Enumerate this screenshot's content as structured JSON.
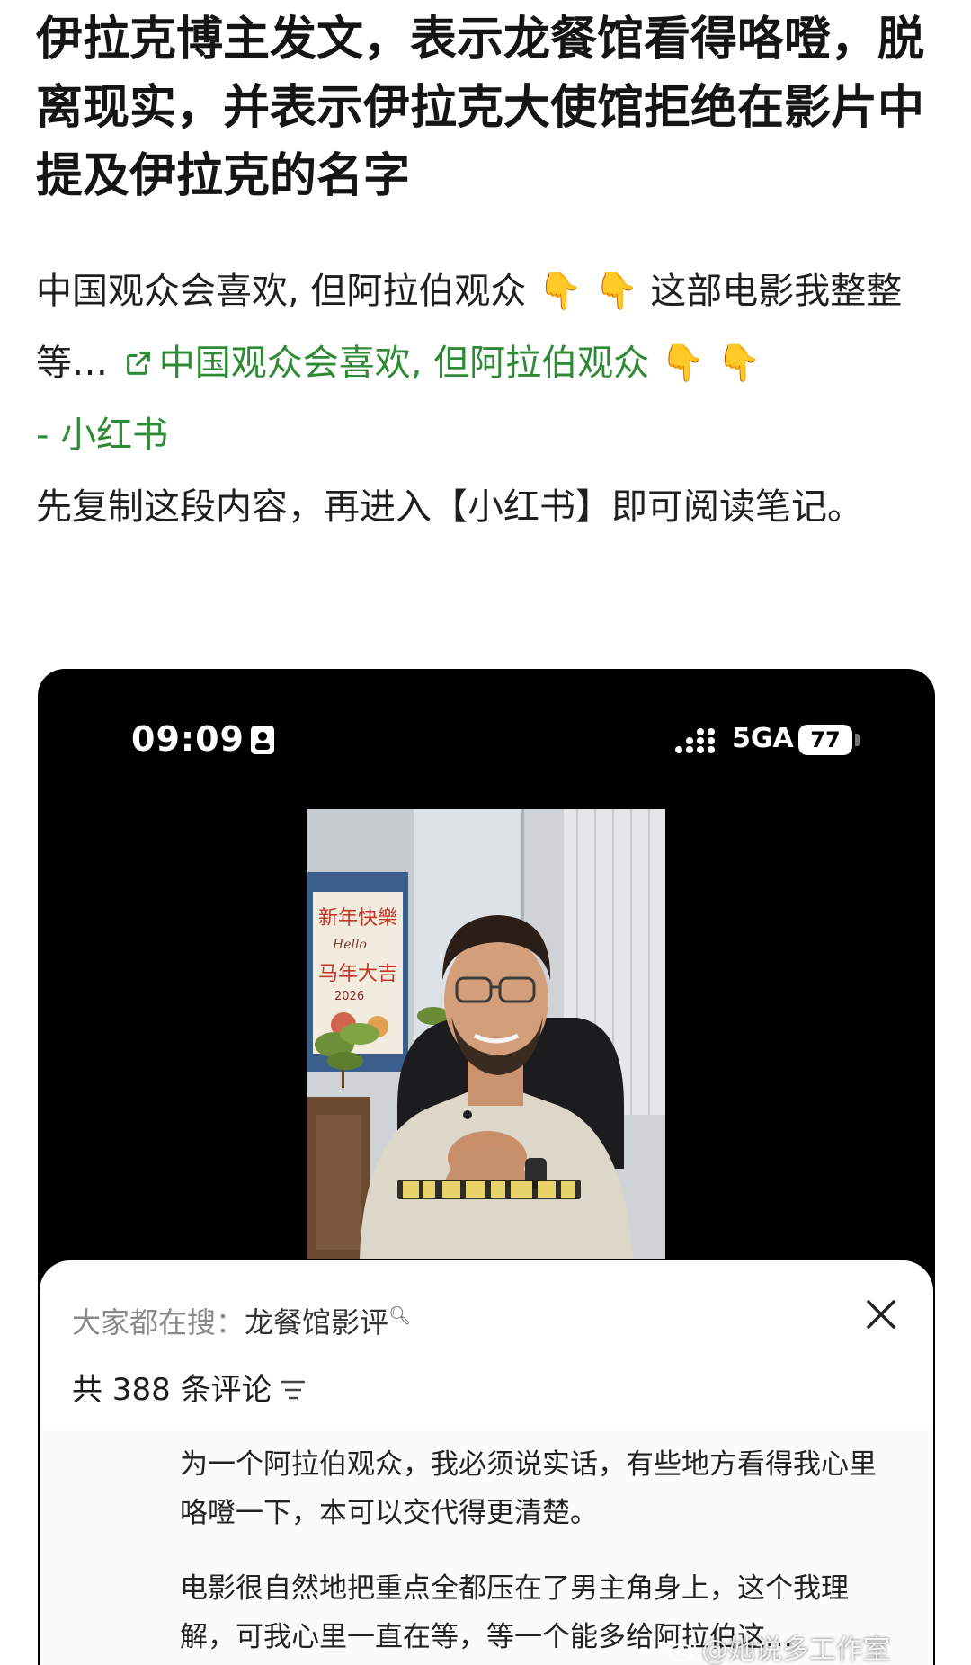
{
  "article": {
    "title": "伊拉克博主发文，表示龙餐馆看得咯噔，脱离现实，并表示伊拉克大使馆拒绝在影片中提及伊拉克的名字",
    "intro": "中国观众会喜欢, 但阿拉伯观众",
    "hand_emoji": "👇",
    "intro_tail": "这部电影我整整等…",
    "link_text": "中国观众会喜欢, 但阿拉伯观众",
    "link_suffix": "- 小红书",
    "copy_tip": "先复制这段内容，再进入【小红书】即可阅读笔记。"
  },
  "phone": {
    "time": "09:09",
    "network": "5GA",
    "battery": "77",
    "poster": {
      "line1": "新年快樂",
      "hello": "Hello",
      "line2": "马年大吉",
      "year": "2026"
    }
  },
  "comments_sheet": {
    "search_prefix": "大家都在搜：",
    "search_keyword": "龙餐馆影评",
    "count_label": "共 388 条评论",
    "comments": [
      {
        "text": "为一个阿拉伯观众，我必须说实话，有些地方看得我心里咯噔一下，本可以交代得更清楚。"
      },
      {
        "text": "电影很自然地把重点全都压在了男主角身上，这个我理解，可我心里一直在等，等一个能多给阿拉伯这…"
      }
    ]
  },
  "watermark": "@她说多工作室"
}
